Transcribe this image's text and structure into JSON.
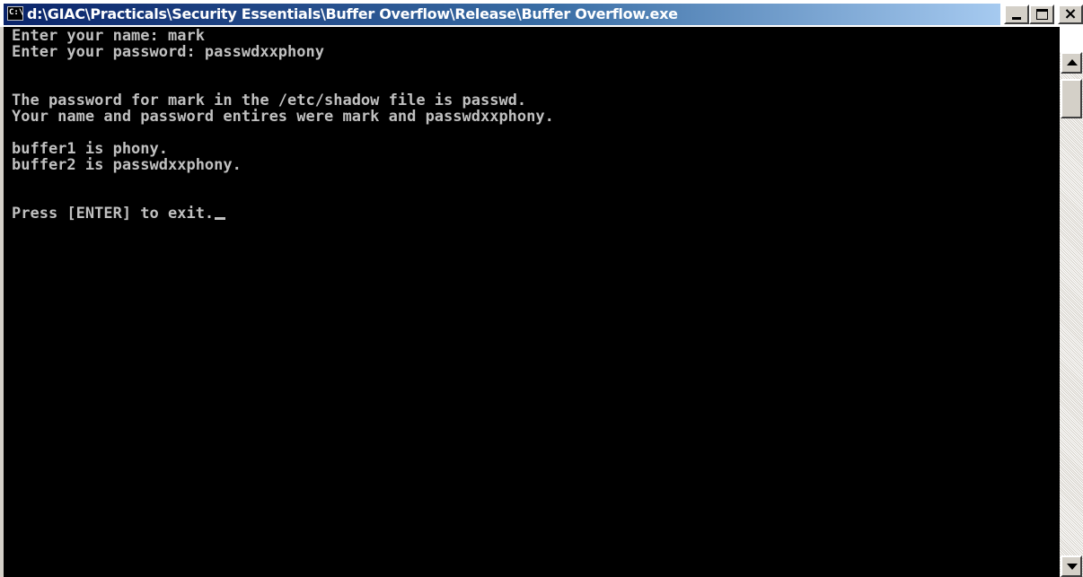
{
  "window": {
    "title": "d:\\GIAC\\Practicals\\Security Essentials\\Buffer Overflow\\Release\\Buffer Overflow.exe",
    "icon_label": "C:\\",
    "icon": "console-app-icon",
    "buttons": {
      "minimize": "minimize-icon",
      "maximize": "maximize-icon",
      "close": "close-icon",
      "close_glyph": "×"
    }
  },
  "console": {
    "lines": [
      "Enter your name: mark",
      "Enter your password: passwdxxphony",
      "",
      "",
      "The password for mark in the /etc/shadow file is passwd.",
      "Your name and password entires were mark and passwdxxphony.",
      "",
      "buffer1 is phony.",
      "buffer2 is passwdxxphony.",
      "",
      "",
      "Press [ENTER] to exit."
    ]
  },
  "scrollbar": {
    "up": "scroll-up-icon",
    "down": "scroll-down-icon"
  },
  "colors": {
    "console_bg": "#000000",
    "console_text": "#c0c0c0",
    "titlebar_start": "#0a246a",
    "titlebar_end": "#a6caf0"
  }
}
